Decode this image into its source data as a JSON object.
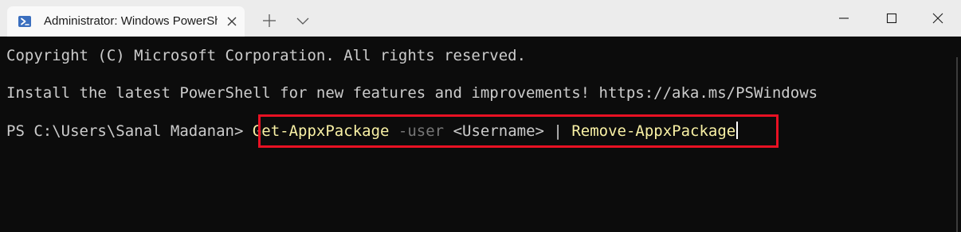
{
  "tab": {
    "title": "Administrator: Windows PowerShell",
    "icon": "powershell-icon"
  },
  "titlebar": {
    "new_tab_icon": "plus-icon",
    "dropdown_icon": "chevron-down-icon",
    "window_controls": [
      "minimize-icon",
      "maximize-icon",
      "close-icon"
    ]
  },
  "terminal": {
    "copyright": "Copyright (C) Microsoft Corporation. All rights reserved.",
    "install_message": "Install the latest PowerShell for new features and improvements! https://aka.ms/PSWindows",
    "prompt": "PS C:\\Users\\Sanal Madanan> ",
    "command": {
      "cmdlet1": "Get-AppxPackage",
      "param": "-user",
      "arg": "<Username>",
      "pipe": "|",
      "cmdlet2": "Remove-AppxPackage"
    }
  },
  "colors": {
    "terminal_background": "#0c0c0c",
    "text": "#cccccc",
    "cmdlet": "#f9f1a5",
    "parameter": "#767676",
    "highlight_border": "#e81123"
  }
}
